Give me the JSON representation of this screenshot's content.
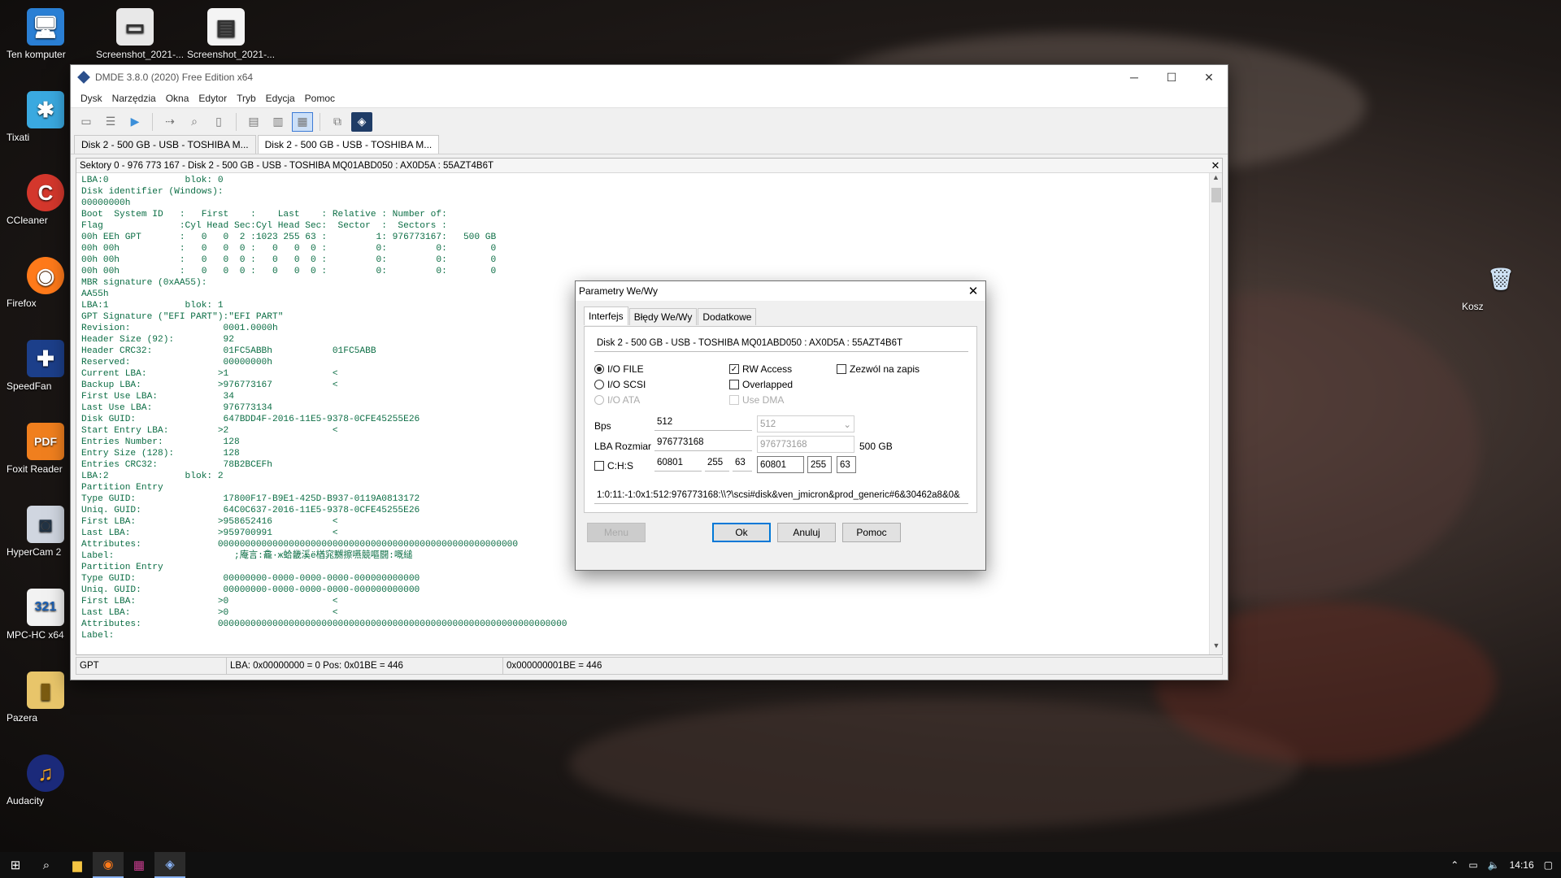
{
  "desktop": {
    "icons": [
      {
        "label": "Ten komputer",
        "icon": "computer-icon"
      },
      {
        "label": "Screenshot_2021-...",
        "icon": "image-file-icon"
      },
      {
        "label": "Screenshot_2021-...",
        "icon": "image-file-icon"
      },
      {
        "label": "Tixati",
        "icon": "tixati-icon"
      },
      {
        "label": "CCleaner",
        "icon": "ccleaner-icon"
      },
      {
        "label": "Firefox",
        "icon": "firefox-icon"
      },
      {
        "label": "SpeedFan",
        "icon": "speedfan-icon"
      },
      {
        "label": "Foxit Reader",
        "icon": "foxit-icon"
      },
      {
        "label": "HyperCam 2",
        "icon": "hypercam-icon"
      },
      {
        "label": "MPC-HC x64",
        "icon": "mpc-icon"
      },
      {
        "label": "Pazera",
        "icon": "folder-icon"
      },
      {
        "label": "Audacity",
        "icon": "audacity-icon"
      },
      {
        "label": "Kosz",
        "icon": "recycle-bin-icon"
      }
    ]
  },
  "window": {
    "title": "DMDE 3.8.0 (2020) Free Edition x64",
    "menu": [
      "Dysk",
      "Narzędzia",
      "Okna",
      "Edytor",
      "Tryb",
      "Edycja",
      "Pomoc"
    ],
    "tabs": [
      "Disk 2 - 500 GB - USB - TOSHIBA M...",
      "Disk 2 - 500 GB - USB - TOSHIBA M..."
    ],
    "pane_title": "Sektory 0 - 976 773 167 - Disk 2 - 500 GB - USB - TOSHIBA MQ01ABD050 : AX0D5A : 55AZT4B6T",
    "hex_lines": [
      "LBA:0              blok: 0",
      "Disk identifier (Windows):",
      "00000000h",
      "Boot  System ID   :   First    :    Last    : Relative : Number of:",
      "Flag              :Cyl Head Sec:Cyl Head Sec:  Sector  :  Sectors :",
      "00h EEh GPT       :   0   0  2 :1023 255 63 :         1: 976773167:   500 GB",
      "00h 00h           :   0   0  0 :   0   0  0 :         0:         0:        0",
      "00h 00h           :   0   0  0 :   0   0  0 :         0:         0:        0",
      "00h 00h           :   0   0  0 :   0   0  0 :         0:         0:        0",
      "MBR signature (0xAA55):",
      "AA55h",
      "LBA:1              blok: 1",
      "GPT Signature (\"EFI PART\"):\"EFI PART\"",
      "Revision:                 0001.0000h",
      "Header Size (92):         92",
      "Header CRC32:             01FC5ABBh           01FC5ABB",
      "Reserved:                 00000000h",
      "Current LBA:             >1                   <",
      "Backup LBA:              >976773167           <",
      "First Use LBA:            34",
      "Last Use LBA:             976773134",
      "Disk GUID:                647BDD4F-2016-11E5-9378-0CFE45255E26",
      "Start Entry LBA:         >2                   <",
      "Entries Number:           128",
      "Entry Size (128):         128",
      "Entries CRC32:            78B2BCEFh",
      "LBA:2              blok: 2",
      "Partition Entry",
      "Type GUID:                17800F17-B9E1-425D-B937-0119A0813172",
      "Uniq. GUID:               64C0C637-2016-11E5-9378-0CFE45255E26",
      "First LBA:               >958652416           <",
      "Last LBA:                >959700991           <",
      "Attributes:              0000000000000000000000000000000000000000000000000000000",
      "Label:                      ;庵言:龕·ж蛤畿溪ё楢窕嬲擦嚥競嘔闘:嘅縋",
      "Partition Entry",
      "Type GUID:                00000000-0000-0000-0000-000000000000",
      "Uniq. GUID:               00000000-0000-0000-0000-000000000000",
      "First LBA:               >0                   <",
      "Last LBA:                >0                   <",
      "Attributes:              0000000000000000000000000000000000000000000000000000000000000000",
      "Label:"
    ],
    "status": {
      "type": "GPT",
      "pos": "LBA: 0x00000000 = 0  Pos: 0x01BE = 446",
      "abs": "0x000000001BE = 446"
    }
  },
  "dialog": {
    "title": "Parametry We/Wy",
    "tabs": [
      "Interfejs",
      "Błędy We/Wy",
      "Dodatkowe"
    ],
    "disk": "Disk 2 - 500 GB - USB - TOSHIBA MQ01ABD050 : AX0D5A : 55AZT4B6T",
    "radios": {
      "io_file": "I/O FILE",
      "io_scsi": "I/O SCSI",
      "io_ata": "I/O ATA"
    },
    "checks": {
      "rw_access": "RW Access",
      "overlapped": "Overlapped",
      "use_dma": "Use DMA",
      "allow_write": "Zezwól na zapis",
      "chs": "C:H:S"
    },
    "bps_label": "Bps",
    "bps_value": "512",
    "bps_detected": "512",
    "lba_label": "LBA Rozmiar",
    "lba_value": "976773168",
    "lba_detected": "976773168",
    "lba_size": "500 GB",
    "chs": {
      "c": "60801",
      "h": "255",
      "s": "63",
      "c2": "60801",
      "h2": "255",
      "s2": "63"
    },
    "path": "1:0:11:-1:0x1:512:976773168:\\\\?\\scsi#disk&ven_jmicron&prod_generic#6&30462a8&0&",
    "buttons": {
      "menu": "Menu",
      "ok": "Ok",
      "cancel": "Anuluj",
      "help": "Pomoc"
    }
  },
  "taskbar": {
    "time": "14:16"
  }
}
